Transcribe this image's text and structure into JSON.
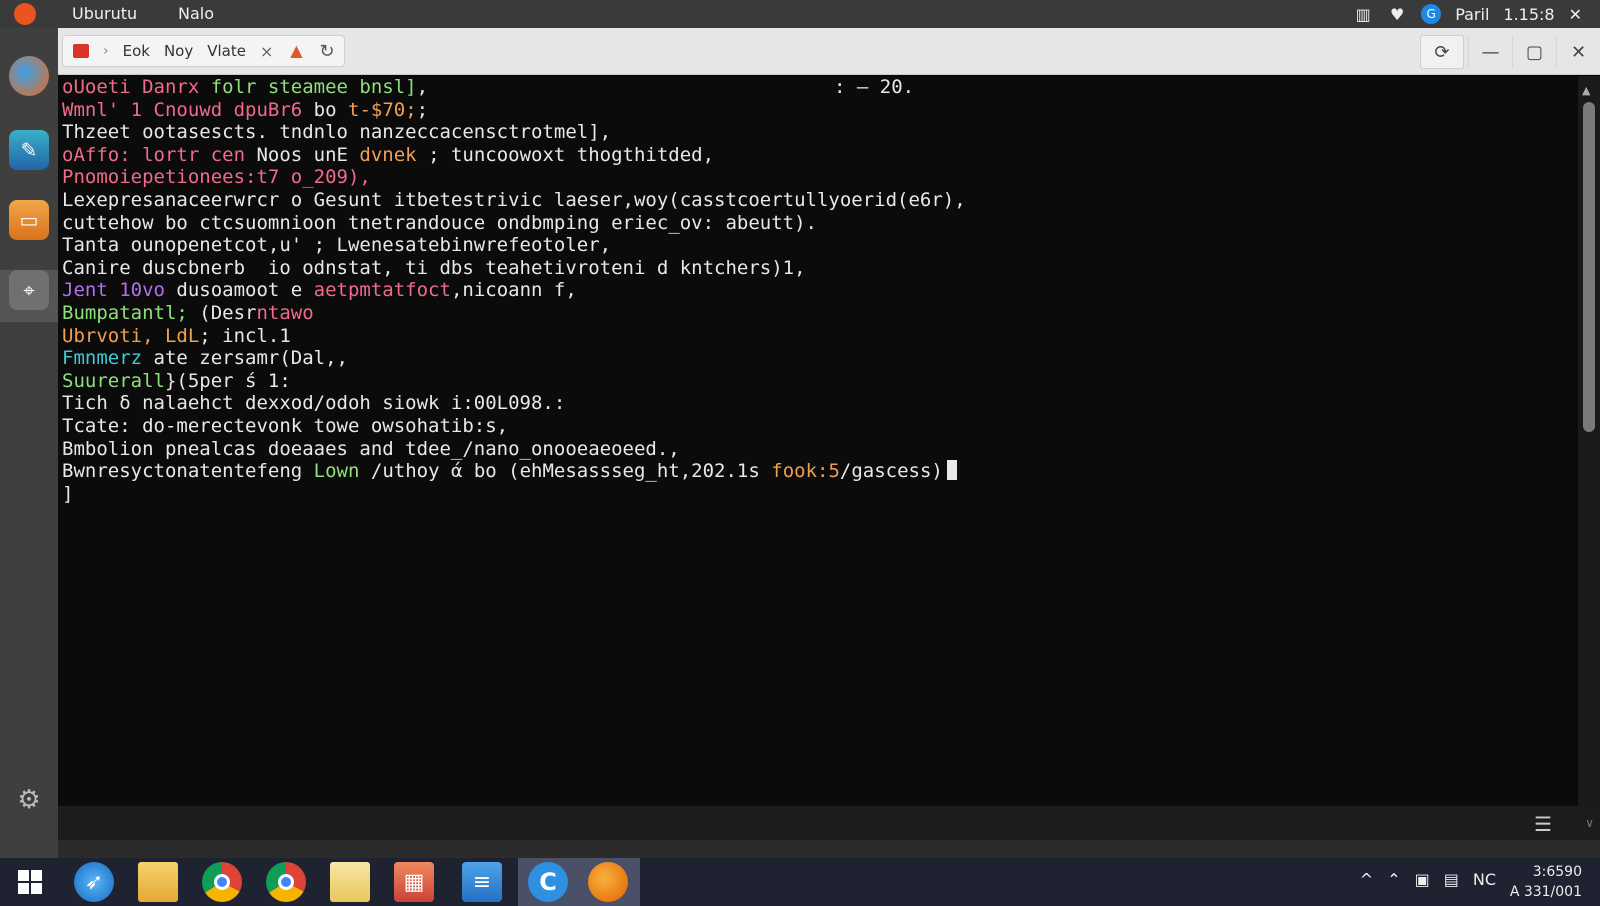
{
  "top_bar": {
    "app_menu": "Uburutu",
    "menu2": "Nalo",
    "status_text": "Paril",
    "time": "1.15:8",
    "close": "✕"
  },
  "window": {
    "tabs": [
      "Eok",
      "Noy",
      "Vlate"
    ],
    "tab_close": "×",
    "controls": {
      "refresh": "⟳",
      "minimize": "—",
      "maximize": "▢",
      "close": "✕"
    }
  },
  "terminal": {
    "status": ": – 20.",
    "lines": [
      [
        {
          "t": "oUoeti Danrx ",
          "c": "#f06a8a"
        },
        {
          "t": "folr steamee bnsl]",
          "c": "#8fe07a"
        },
        {
          "t": ",",
          "c": "#e8e8e8"
        }
      ],
      [
        {
          "t": "Wmnl' 1 Cnouwd dpuBr6 ",
          "c": "#f06a8a"
        },
        {
          "t": "bo ",
          "c": "#e8e8e8"
        },
        {
          "t": "t-$70;",
          "c": "#f0a050"
        },
        {
          "t": ";",
          "c": "#e8e8e8"
        }
      ],
      [
        {
          "t": "Thzeet ootasescts. tndnlo nanzeccacensctrotmel],",
          "c": "#e8e8e8"
        }
      ],
      [
        {
          "t": "oAffo: lortr cen ",
          "c": "#f06a8a"
        },
        {
          "t": "Noos unE ",
          "c": "#e8e8e8"
        },
        {
          "t": "dvnek ",
          "c": "#f0a050"
        },
        {
          "t": "; tuncoowoxt thogthitded,",
          "c": "#e8e8e8"
        }
      ],
      [
        {
          "t": "Pnomoiepetionees:t7 o_209),",
          "c": "#f06a8a"
        }
      ],
      [
        {
          "t": "Lexepresanaceerwrcr o Gesunt itbetestrivic laeser,woy(casstcoertullyoerid(e6r),",
          "c": "#e8e8e8"
        }
      ],
      [
        {
          "t": "cuttehow bo ctcsuomnioon tnetrandouce ondbmping eriec_ov: abeutt).",
          "c": "#e8e8e8"
        }
      ],
      [
        {
          "t": "Tanta ounopenetcot,u' ; Lwenesatebinwrefeotoler,",
          "c": "#e8e8e8"
        }
      ],
      [
        {
          "t": "Canire duscbnerb  io odnstat, ti dbs teahetivroteni d kntchers)1,",
          "c": "#e8e8e8"
        }
      ],
      [
        {
          "t": "Jent 10vo ",
          "c": "#b070f0"
        },
        {
          "t": "dusoamoot e ",
          "c": "#e8e8e8"
        },
        {
          "t": "aetpmtatfoct",
          "c": "#f06a8a"
        },
        {
          "t": ",nicoann f,",
          "c": "#e8e8e8"
        }
      ],
      [
        {
          "t": "Bumpatantl; ",
          "c": "#8fe07a"
        },
        {
          "t": "(Desr",
          "c": "#e8e8e8"
        },
        {
          "t": "ntawo",
          "c": "#f06a8a"
        }
      ],
      [
        {
          "t": "Ubrvoti, LdL",
          "c": "#f0a050"
        },
        {
          "t": "; incl.1",
          "c": "#e8e8e8"
        }
      ],
      [
        {
          "t": "Fmnmerz ",
          "c": "#40c8d8"
        },
        {
          "t": "ate zersamr(Dal,,",
          "c": "#e8e8e8"
        }
      ],
      [
        {
          "t": "Suurerall",
          "c": "#8fe07a"
        },
        {
          "t": "}(5per ś 1:",
          "c": "#e8e8e8"
        }
      ],
      [
        {
          "t": "Tich δ nalaehct dexxod/odoh siowk i:00L098.:",
          "c": "#e8e8e8"
        }
      ],
      [
        {
          "t": "Tcate: do-merectevonk towe owsohatib:s,",
          "c": "#e8e8e8"
        }
      ],
      [
        {
          "t": "Bmbolion pnealcas doeaaes and tdee_/nano_onooeaeoeed.,",
          "c": "#e8e8e8"
        }
      ],
      [
        {
          "t": "Bwnresyctonatentefeng ",
          "c": "#e8e8e8"
        },
        {
          "t": "Lown ",
          "c": "#8fe07a"
        },
        {
          "t": "/uthoy ά bo (ehMesassseg̲ht,202.1s ",
          "c": "#e8e8e8"
        },
        {
          "t": "fook:5",
          "c": "#f0a050"
        },
        {
          "t": "/gascess)",
          "c": "#e8e8e8"
        }
      ],
      [
        {
          "t": "]",
          "c": "#e8e8e8"
        }
      ]
    ]
  },
  "taskbar": {
    "tray_label": "NC",
    "clock_line1": "3:6590",
    "clock_line2": "A 331/001"
  },
  "colors": {
    "terminal_bg": "#0b0b0b",
    "top_bar_bg": "#3a3a3a",
    "taskbar_bg": "#1f2230",
    "accent": "#e95420"
  }
}
